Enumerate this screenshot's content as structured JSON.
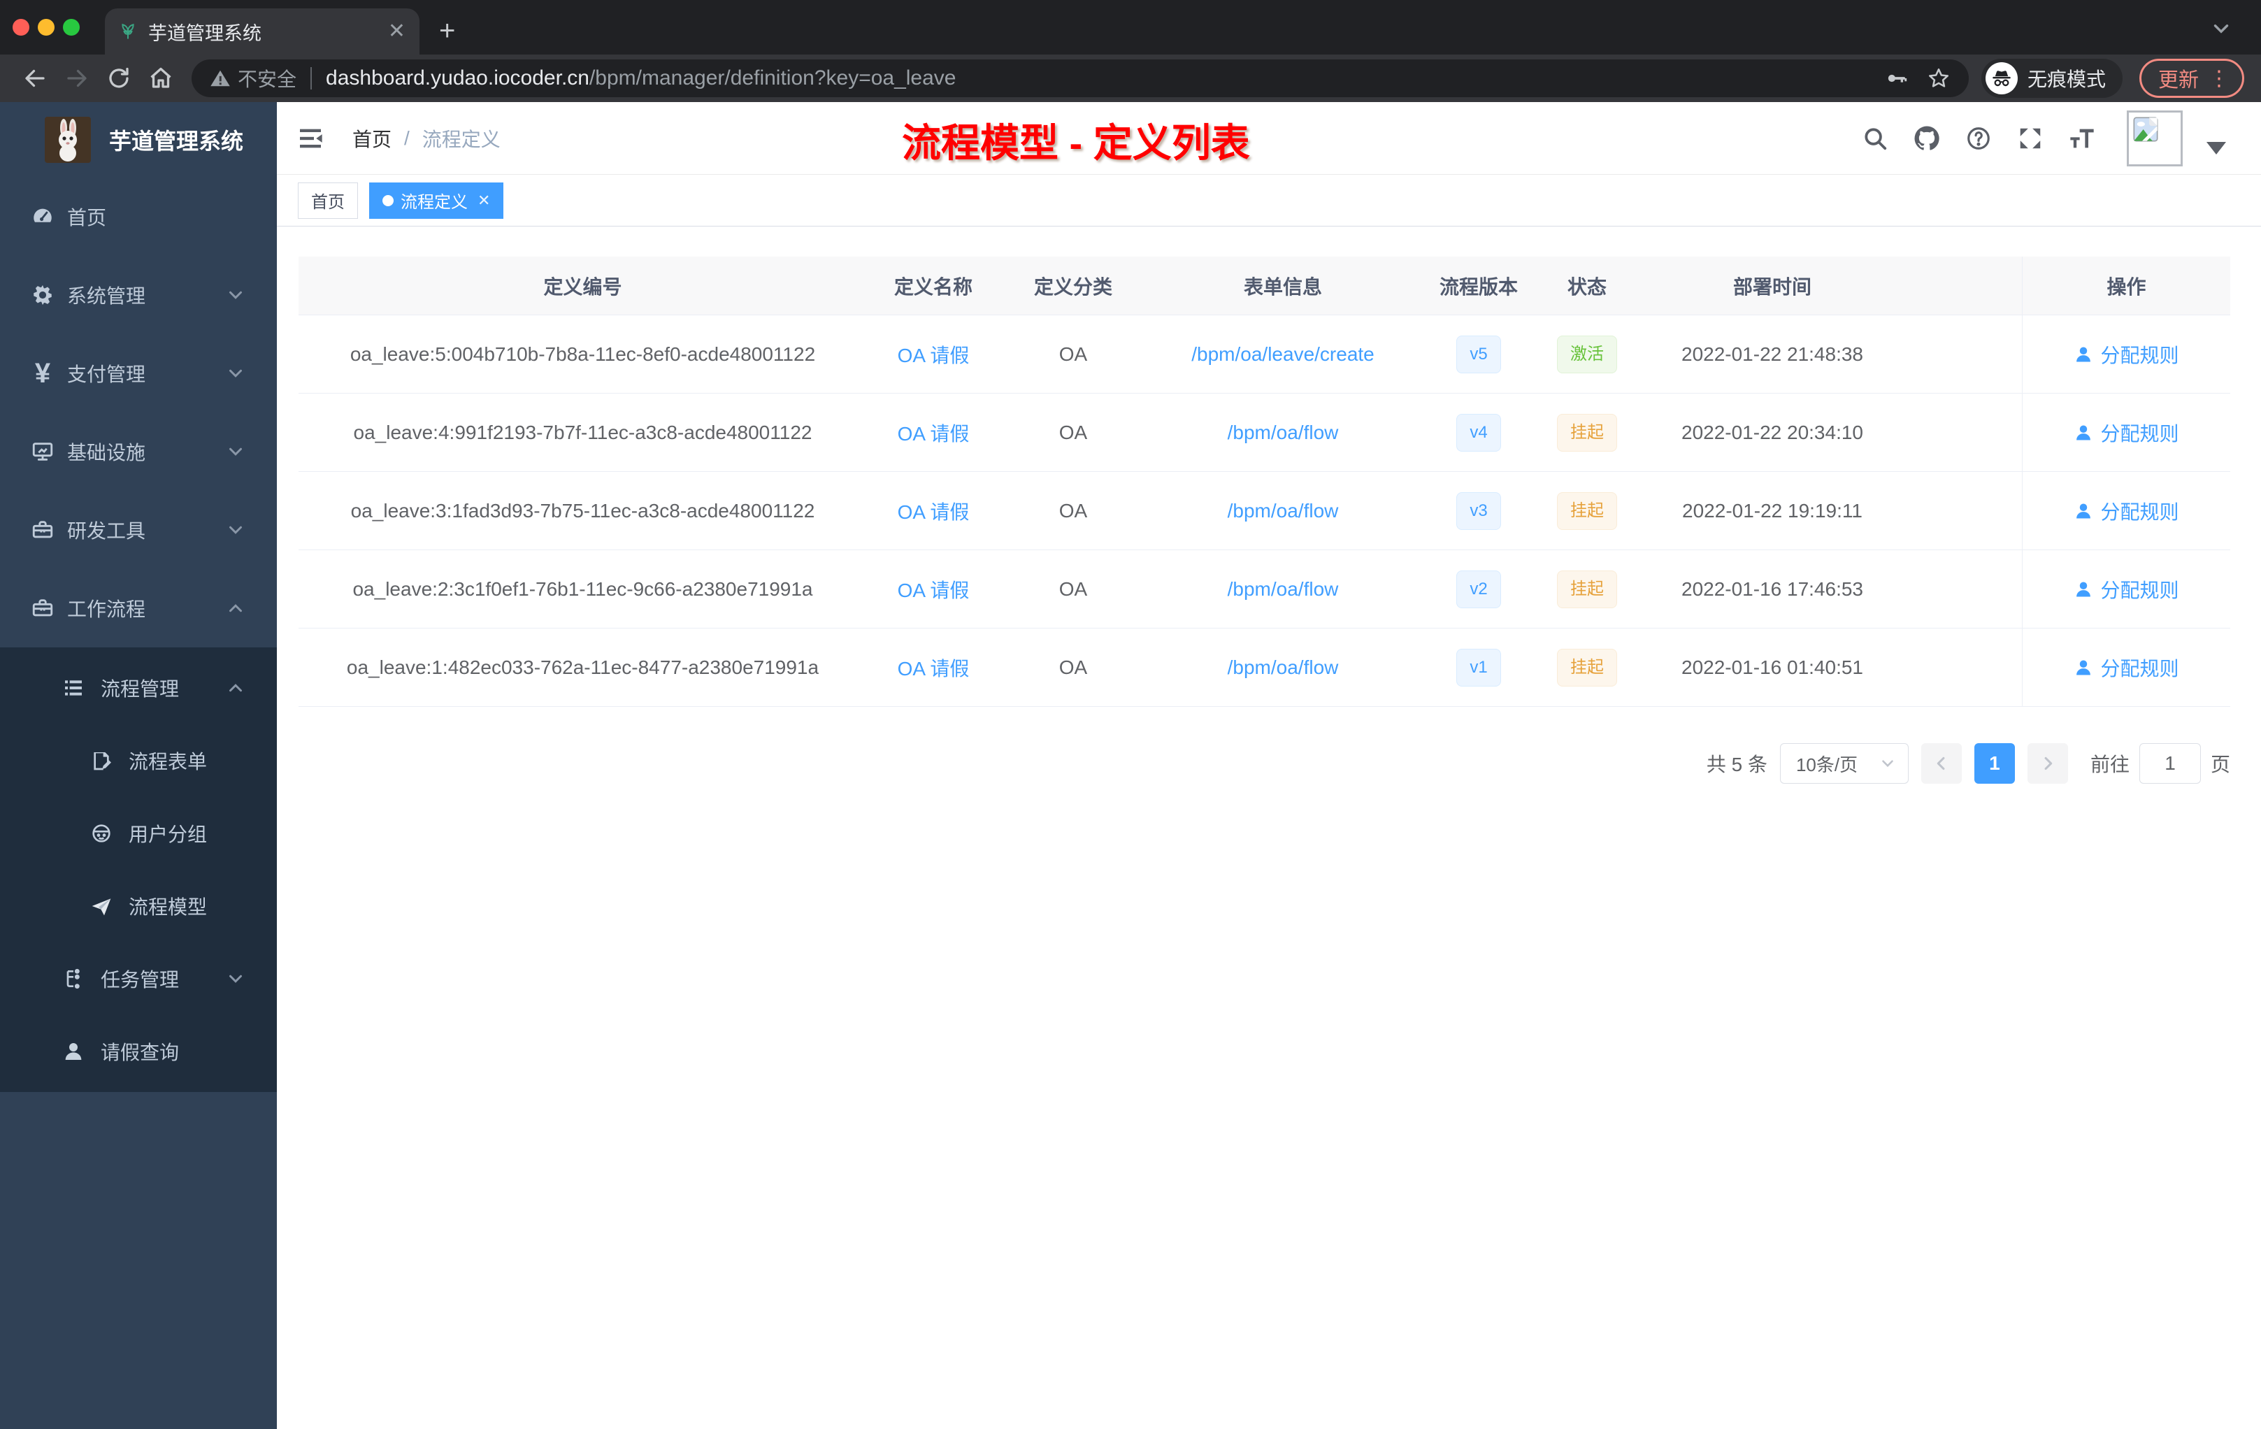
{
  "browser": {
    "tab_title": "芋道管理系统",
    "security_label": "不安全",
    "url_domain": "dashboard.yudao.iocoder.cn",
    "url_path": "/bpm/manager/definition?key=oa_leave",
    "incognito_label": "无痕模式",
    "update_label": "更新"
  },
  "sidebar": {
    "logo_title": "芋道管理系统",
    "items": [
      {
        "label": "首页"
      },
      {
        "label": "系统管理"
      },
      {
        "label": "支付管理"
      },
      {
        "label": "基础设施"
      },
      {
        "label": "研发工具"
      },
      {
        "label": "工作流程"
      },
      {
        "label": "流程管理"
      },
      {
        "label": "流程表单"
      },
      {
        "label": "用户分组"
      },
      {
        "label": "流程模型"
      },
      {
        "label": "任务管理"
      },
      {
        "label": "请假查询"
      }
    ]
  },
  "navbar": {
    "breadcrumb": {
      "home": "首页",
      "separator": "/",
      "current": "流程定义"
    },
    "annotation": "流程模型 - 定义列表"
  },
  "tags": [
    {
      "label": "首页"
    },
    {
      "label": "流程定义"
    }
  ],
  "table": {
    "headers": [
      {
        "label": "定义编号"
      },
      {
        "label": "定义名称"
      },
      {
        "label": "定义分类"
      },
      {
        "label": "表单信息"
      },
      {
        "label": "流程版本"
      },
      {
        "label": "状态"
      },
      {
        "label": "部署时间"
      },
      {
        "label": "操作"
      }
    ],
    "rows": [
      {
        "id": "oa_leave:5:004b710b-7b8a-11ec-8ef0-acde48001122",
        "name": "OA 请假",
        "category": "OA",
        "form": "/bpm/oa/leave/create",
        "version": "v5",
        "status": "激活",
        "time": "2022-01-22 21:48:38",
        "action": "分配规则"
      },
      {
        "id": "oa_leave:4:991f2193-7b7f-11ec-a3c8-acde48001122",
        "name": "OA 请假",
        "category": "OA",
        "form": "/bpm/oa/flow",
        "version": "v4",
        "status": "挂起",
        "time": "2022-01-22 20:34:10",
        "action": "分配规则"
      },
      {
        "id": "oa_leave:3:1fad3d93-7b75-11ec-a3c8-acde48001122",
        "name": "OA 请假",
        "category": "OA",
        "form": "/bpm/oa/flow",
        "version": "v3",
        "status": "挂起",
        "time": "2022-01-22 19:19:11",
        "action": "分配规则"
      },
      {
        "id": "oa_leave:2:3c1f0ef1-76b1-11ec-9c66-a2380e71991a",
        "name": "OA 请假",
        "category": "OA",
        "form": "/bpm/oa/flow",
        "version": "v2",
        "status": "挂起",
        "time": "2022-01-16 17:46:53",
        "action": "分配规则"
      },
      {
        "id": "oa_leave:1:482ec033-762a-11ec-8477-a2380e71991a",
        "name": "OA 请假",
        "category": "OA",
        "form": "/bpm/oa/flow",
        "version": "v1",
        "status": "挂起",
        "time": "2022-01-16 01:40:51",
        "action": "分配规则"
      }
    ]
  },
  "pagination": {
    "total": "共 5 条",
    "page_size": "10条/页",
    "current_page": "1",
    "goto_label": "前往",
    "goto_value": "1",
    "page_unit": "页"
  },
  "colors": {
    "accent": "#409eff",
    "success": "#67c23a",
    "warning": "#e6a23c",
    "annotation_red": "#ff0000",
    "sidebar_bg": "#304156",
    "submenu_bg": "#1f2d3d"
  }
}
